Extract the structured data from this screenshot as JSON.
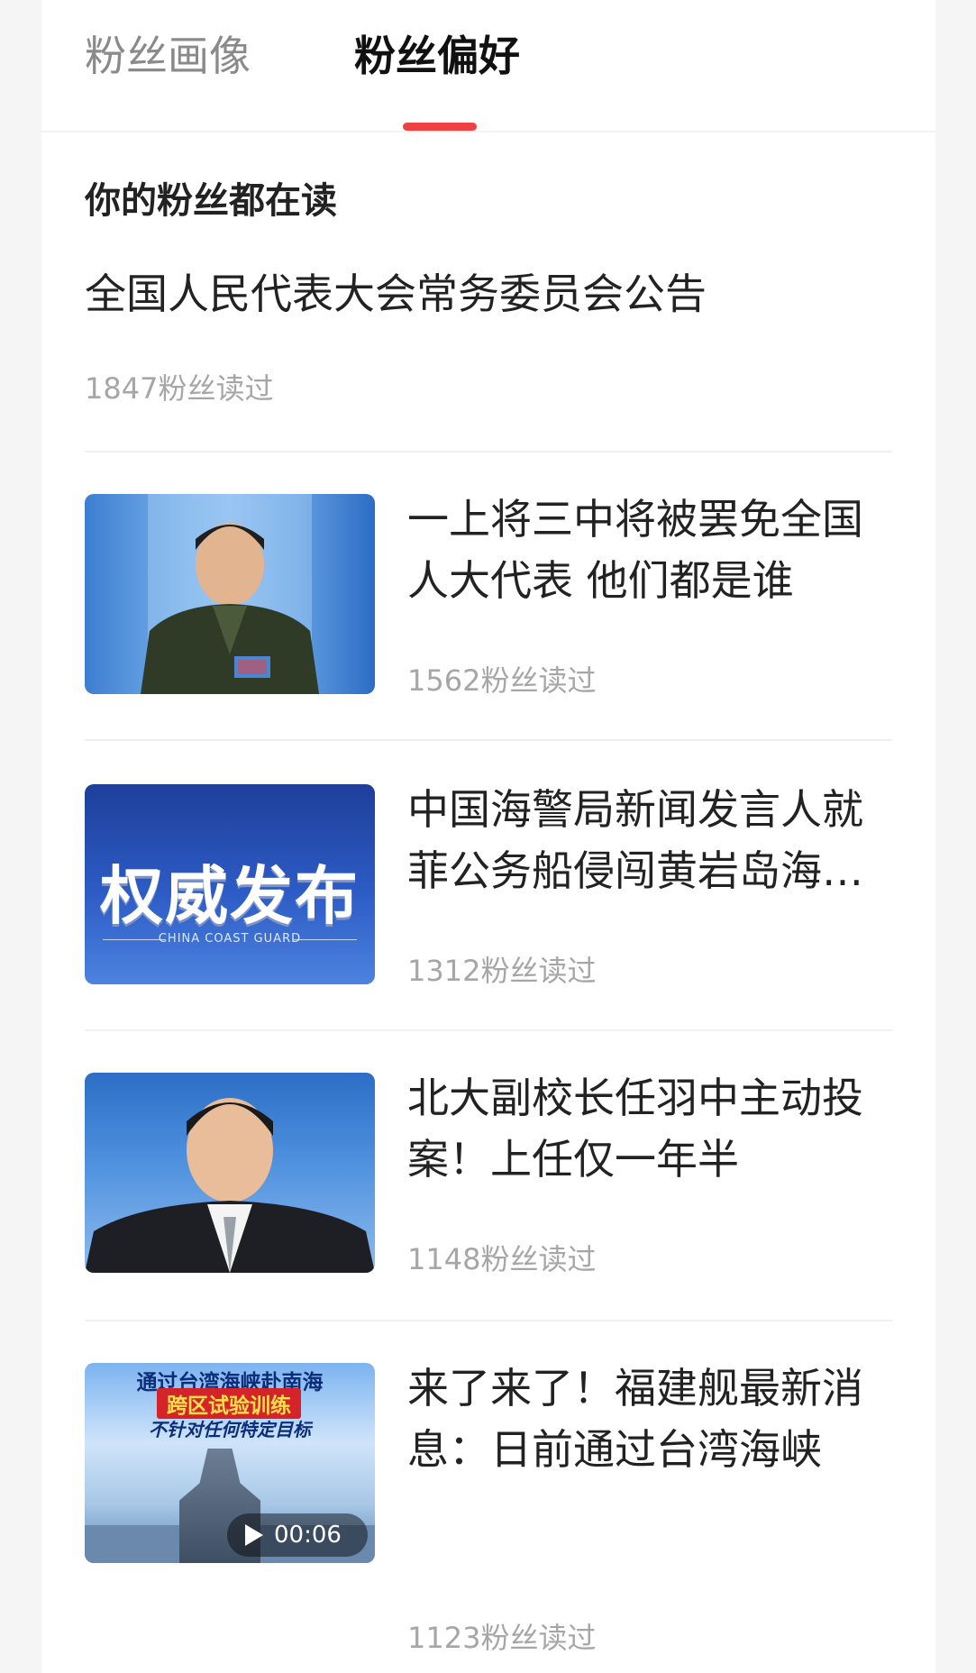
{
  "tabs": {
    "portrait": "粉丝画像",
    "preference": "粉丝偏好"
  },
  "colors": {
    "accent": "#f04142"
  },
  "section_title": "你的粉丝都在读",
  "featured": {
    "title": "全国人民代表大会常务委员会公告",
    "meta": "1847粉丝读过"
  },
  "news": [
    {
      "title": "一上将三中将被罢免全国人大代表 他们都是谁",
      "meta": "1562粉丝读过"
    },
    {
      "title": "中国海警局新闻发言人就菲公务船侵闯黄岩岛海域发表谈话",
      "meta": "1312粉丝读过",
      "thumb_text": "权威发布",
      "thumb_sub": "CHINA COAST GUARD"
    },
    {
      "title": "北大副校长任羽中主动投案！上任仅一年半",
      "meta": "1148粉丝读过"
    },
    {
      "title": "来了来了！福建舰最新消息：日前通过台湾海峡",
      "meta": "1123粉丝读过",
      "overlay": [
        "通过台湾海峡赴南海",
        "跨区试验训练",
        "不针对任何特定目标"
      ],
      "video_duration": "00:06"
    }
  ]
}
